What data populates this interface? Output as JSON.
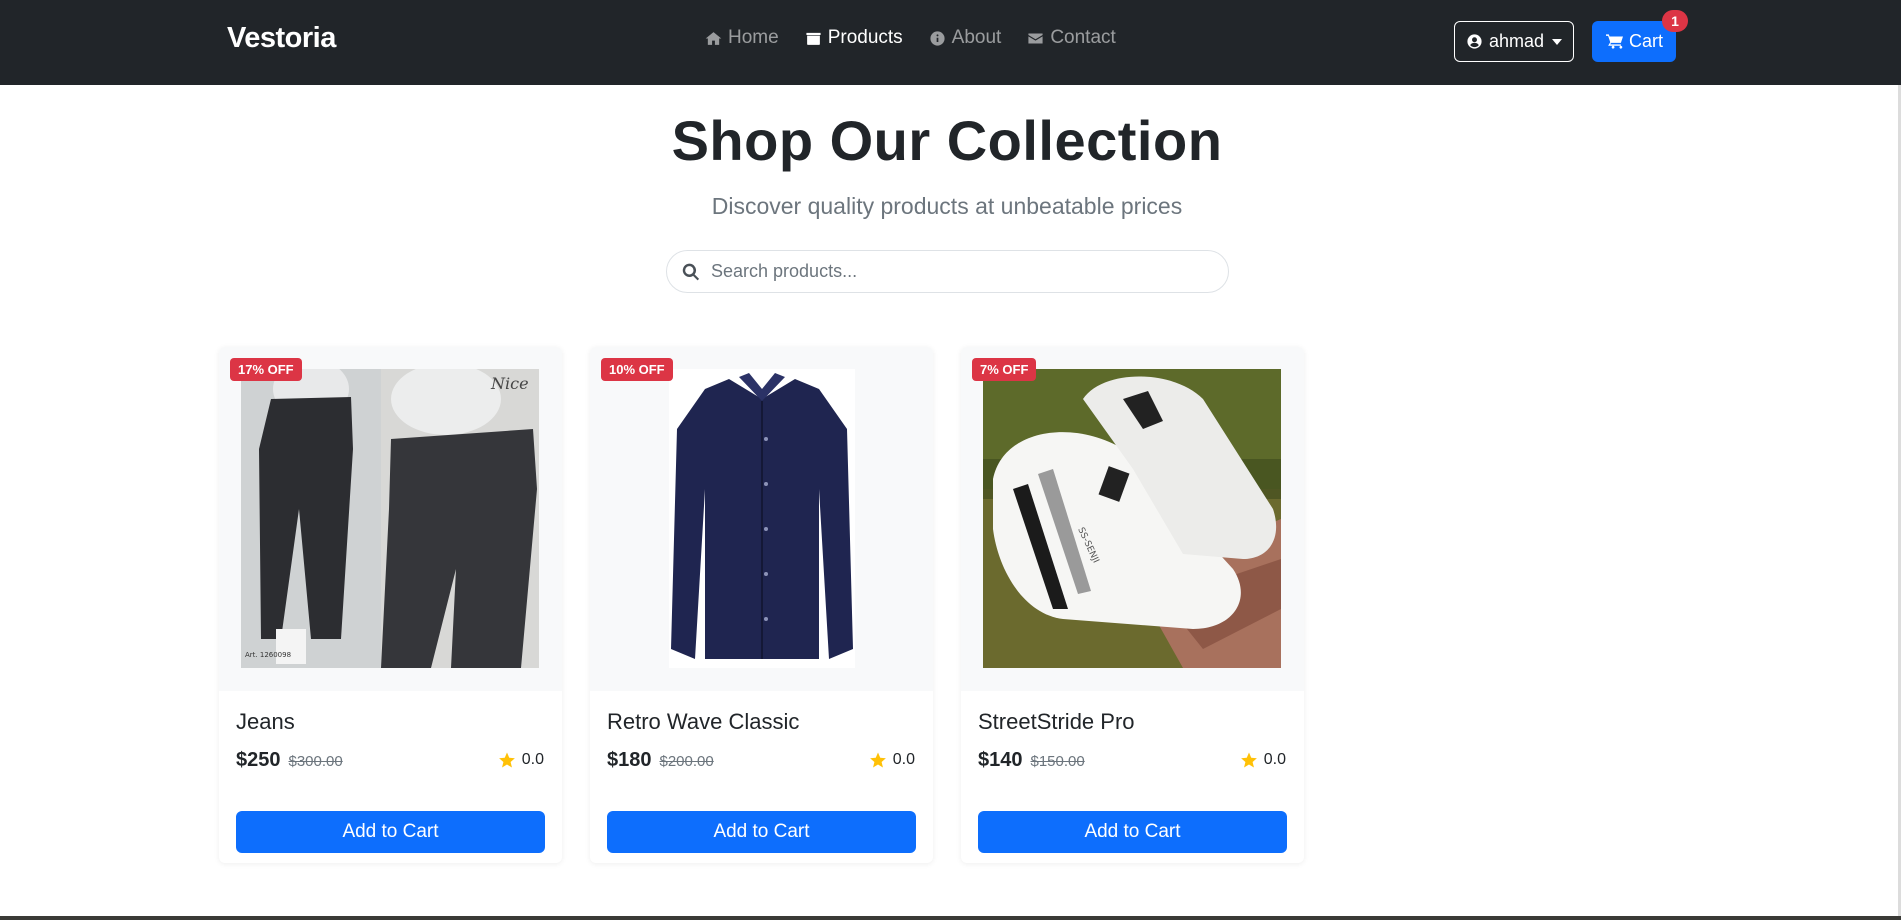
{
  "brand": "Vestoria",
  "nav": [
    {
      "label": "Home",
      "icon": "home-icon",
      "active": false
    },
    {
      "label": "Products",
      "icon": "box-icon",
      "active": true
    },
    {
      "label": "About",
      "icon": "info-icon",
      "active": false
    },
    {
      "label": "Contact",
      "icon": "envelope-icon",
      "active": false
    }
  ],
  "user": {
    "name": "ahmad"
  },
  "cart": {
    "label": "Cart",
    "count": "1"
  },
  "hero": {
    "title": "Shop Our Collection",
    "subtitle": "Discover quality products at unbeatable prices"
  },
  "search": {
    "placeholder": "Search products..."
  },
  "products": [
    {
      "name": "Jeans",
      "price": "$250",
      "old_price": "$300.00",
      "discount": "17% OFF",
      "rating": "0.0",
      "button": "Add to Cart",
      "image": "black-jeans-photo"
    },
    {
      "name": "Retro Wave Classic",
      "price": "$180",
      "old_price": "$200.00",
      "discount": "10% OFF",
      "rating": "0.0",
      "button": "Add to Cart",
      "image": "navy-shirt-photo"
    },
    {
      "name": "StreetStride Pro",
      "price": "$140",
      "old_price": "$150.00",
      "discount": "7% OFF",
      "rating": "0.0",
      "button": "Add to Cart",
      "image": "white-sneakers-photo"
    }
  ],
  "colors": {
    "navbar": "#212529",
    "primary": "#0d6efd",
    "danger": "#dc3545",
    "star": "#ffc107"
  }
}
